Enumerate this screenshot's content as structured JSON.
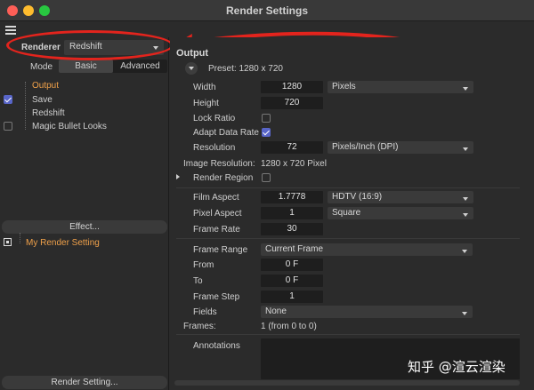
{
  "window": {
    "title": "Render Settings"
  },
  "renderer": {
    "label": "Renderer",
    "value": "Redshift"
  },
  "mode": {
    "label": "Mode",
    "tabs": [
      "Basic",
      "Advanced"
    ],
    "active": "Basic"
  },
  "tree": {
    "items": [
      {
        "label": "Output",
        "checked": true,
        "selected": true
      },
      {
        "label": "Save",
        "checked": true,
        "selected": false
      },
      {
        "label": "Redshift",
        "checked": false,
        "selected": false
      },
      {
        "label": "Magic Bullet Looks",
        "checked": false,
        "selected": false
      }
    ]
  },
  "left_buttons": {
    "effect": "Effect...",
    "render_setting": "Render Setting..."
  },
  "render_setting_name": "My Render Setting",
  "output": {
    "title": "Output",
    "preset": "Preset: 1280 x 720",
    "width": {
      "label": "Width",
      "value": "1280",
      "unit": "Pixels"
    },
    "height": {
      "label": "Height",
      "value": "720"
    },
    "lock_ratio": {
      "label": "Lock Ratio",
      "checked": false
    },
    "adapt_data_rate": {
      "label": "Adapt Data Rate",
      "checked": true
    },
    "resolution": {
      "label": "Resolution",
      "value": "72",
      "unit": "Pixels/Inch (DPI)"
    },
    "image_resolution": {
      "label": "Image Resolution:",
      "value": "1280 x 720 Pixel"
    },
    "render_region": {
      "label": "Render Region",
      "checked": false
    },
    "film_aspect": {
      "label": "Film Aspect",
      "value": "1.7778",
      "preset": "HDTV (16:9)"
    },
    "pixel_aspect": {
      "label": "Pixel Aspect",
      "value": "1",
      "preset": "Square"
    },
    "frame_rate": {
      "label": "Frame Rate",
      "value": "30"
    },
    "frame_range": {
      "label": "Frame Range",
      "value": "Current Frame"
    },
    "from": {
      "label": "From",
      "value": "0 F"
    },
    "to": {
      "label": "To",
      "value": "0 F"
    },
    "frame_step": {
      "label": "Frame Step",
      "value": "1"
    },
    "fields": {
      "label": "Fields",
      "value": "None"
    },
    "frames": {
      "label": "Frames:",
      "value": "1 (from 0 to 0)"
    },
    "annotations": {
      "label": "Annotations",
      "value": ""
    }
  },
  "watermark": "知乎 @渲云渲染",
  "colors": {
    "accent_orange": "#f0a14a",
    "check_blue": "#5865c8",
    "annotation_red": "#e3241d"
  }
}
